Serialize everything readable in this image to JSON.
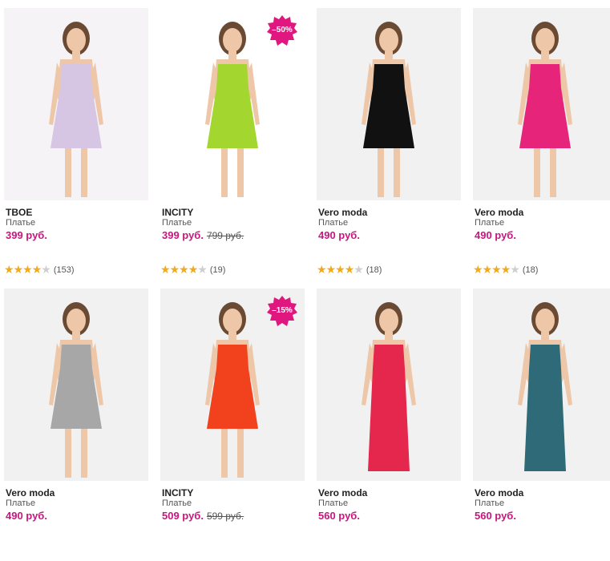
{
  "products": [
    {
      "brand": "TBOE",
      "category": "Платье",
      "price": "399 руб.",
      "old_price": "",
      "discount": "",
      "rating": 4,
      "reviews": "(153)",
      "dress_color": "#d7c6e3",
      "photo_bg": "#f6f3f7",
      "icon": "dress-photo-icon"
    },
    {
      "brand": "INCITY",
      "category": "Платье",
      "price": "399 руб.",
      "old_price": "799 руб.",
      "discount": "–50%",
      "rating": 4,
      "reviews": "(19)",
      "dress_color": "#a3d62f",
      "photo_bg": "#ffffff",
      "icon": "dress-photo-icon"
    },
    {
      "brand": "Vero moda",
      "category": "Платье",
      "price": "490 руб.",
      "old_price": "",
      "discount": "",
      "rating": 4,
      "reviews": "(18)",
      "dress_color": "#111111",
      "photo_bg": "#f1f1f1",
      "icon": "dress-photo-icon"
    },
    {
      "brand": "Vero moda",
      "category": "Платье",
      "price": "490 руб.",
      "old_price": "",
      "discount": "",
      "rating": 4,
      "reviews": "(18)",
      "dress_color": "#e6247a",
      "photo_bg": "#f1f1f1",
      "icon": "dress-photo-icon"
    },
    {
      "brand": "Vero moda",
      "category": "Платье",
      "price": "490 руб.",
      "old_price": "",
      "discount": "",
      "rating": 0,
      "reviews": "",
      "dress_color": "#a7a7a7",
      "photo_bg": "#f1f1f1",
      "icon": "dress-photo-icon"
    },
    {
      "brand": "INCITY",
      "category": "Платье",
      "price": "509 руб.",
      "old_price": "599 руб.",
      "discount": "–15%",
      "rating": 0,
      "reviews": "",
      "dress_color": "#f1421d",
      "photo_bg": "#f1f1f1",
      "icon": "dress-photo-icon"
    },
    {
      "brand": "Vero moda",
      "category": "Платье",
      "price": "560 руб.",
      "old_price": "",
      "discount": "",
      "rating": 0,
      "reviews": "",
      "dress_color": "#e5264d",
      "photo_bg": "#f1f1f1",
      "icon": "dress-photo-icon"
    },
    {
      "brand": "Vero moda",
      "category": "Платье",
      "price": "560 руб.",
      "old_price": "",
      "discount": "",
      "rating": 0,
      "reviews": "",
      "dress_color": "#2e6a78",
      "photo_bg": "#f1f1f1",
      "icon": "dress-photo-icon"
    }
  ],
  "colors": {
    "price": "#c8167f",
    "badge": "#e0177e",
    "star_on": "#f2a91a",
    "star_off": "#cfcfcf"
  }
}
